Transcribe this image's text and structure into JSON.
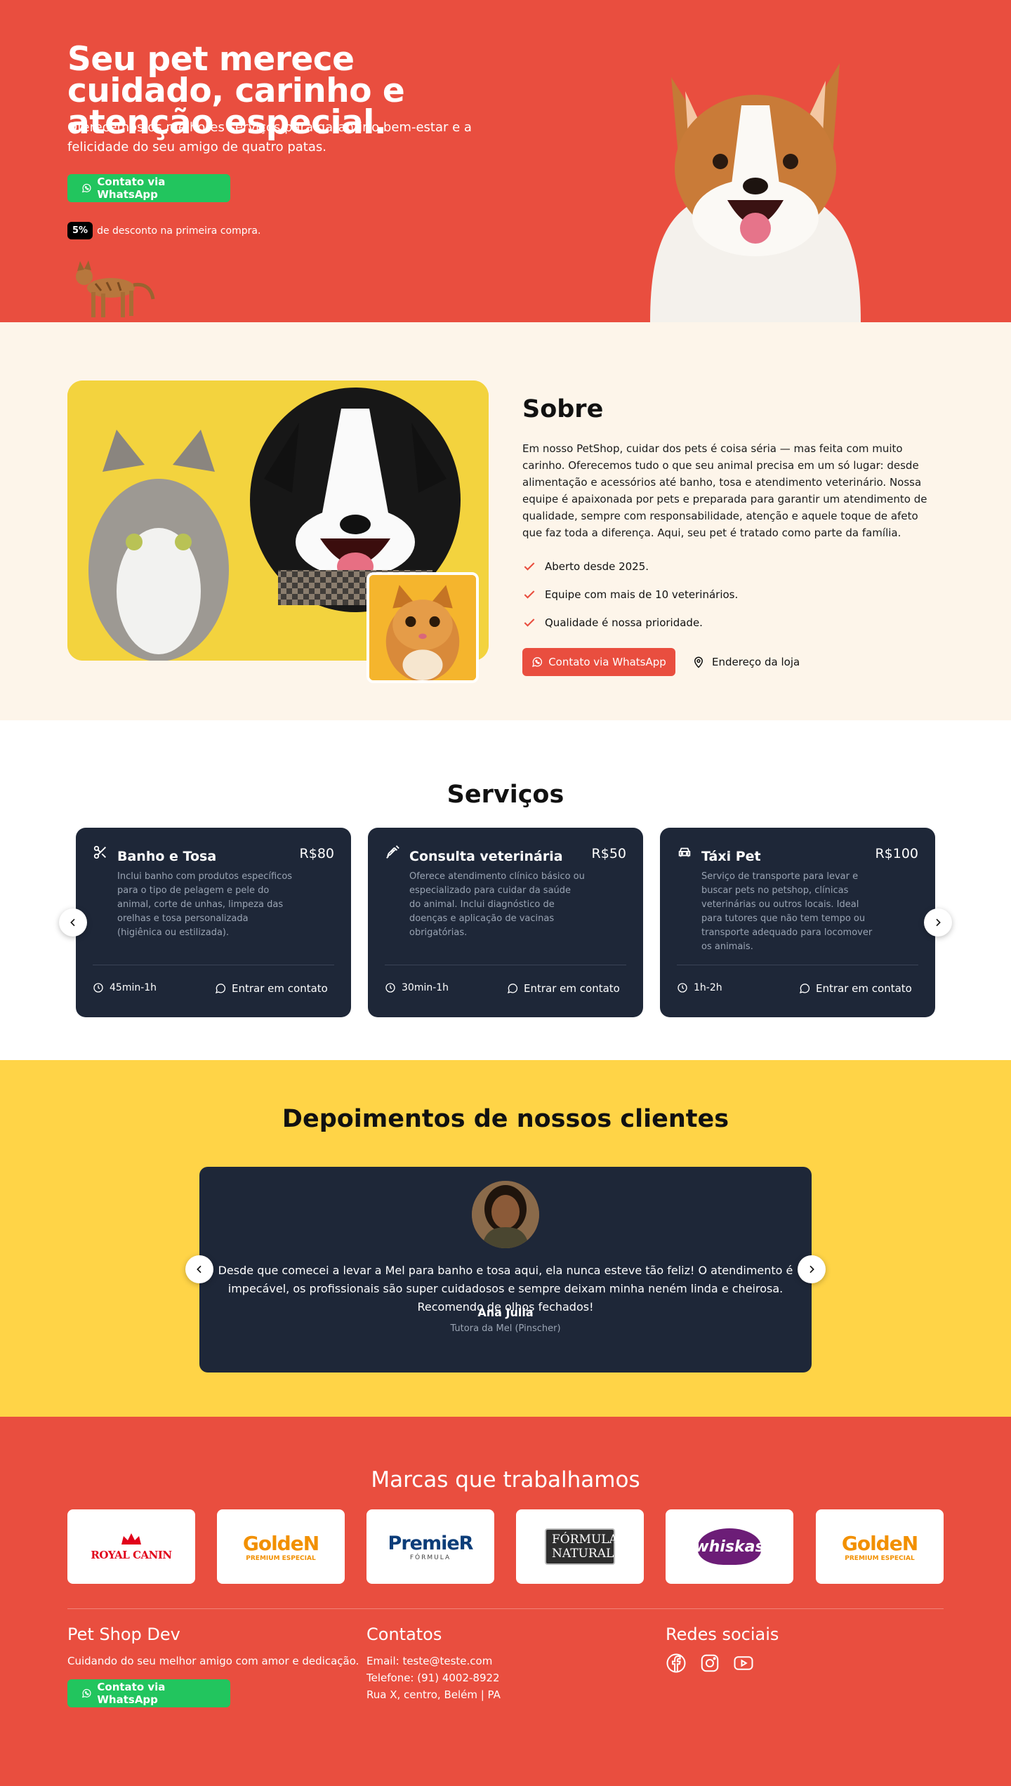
{
  "colors": {
    "primary": "#e94e3f",
    "whatsapp": "#22c55e",
    "dark_card": "#1e2738",
    "cream": "#fdf5ea",
    "yellow": "#ffd447"
  },
  "hero": {
    "title": "Seu pet merece cuidado, carinho e atenção especial.",
    "subtitle": "Oferecemos os melhores serviços para garantir o bem-estar e a felicidade do seu amigo de quatro patas.",
    "cta_label": "Contato via WhatsApp",
    "discount_badge": "5%",
    "discount_text": "de desconto na primeira compra."
  },
  "about": {
    "title": "Sobre",
    "paragraph": "Em nosso PetShop, cuidar dos pets é coisa séria — mas feita com muito carinho. Oferecemos tudo o que seu animal precisa em um só lugar: desde alimentação e acessórios até banho, tosa e atendimento veterinário. Nossa equipe é apaixonada por pets e preparada para garantir um atendimento de qualidade, sempre com responsabilidade, atenção e aquele toque de afeto que faz toda a diferença. Aqui, seu pet é tratado como parte da família.",
    "features": [
      "Aberto desde 2025.",
      "Equipe com mais de 10 veterinários.",
      "Qualidade é nossa prioridade."
    ],
    "cta_label": "Contato via WhatsApp",
    "address_label": "Endereço da loja"
  },
  "services": {
    "title": "Serviços",
    "items": [
      {
        "icon": "scissors-icon",
        "name": "Banho e Tosa",
        "price": "R$80",
        "description": "Inclui banho com produtos específicos para o tipo de pelagem e pele do animal, corte de unhas, limpeza das orelhas e tosa personalizada (higiênica ou estilizada).",
        "duration": "45min-1h",
        "contact": "Entrar em contato"
      },
      {
        "icon": "syringe-icon",
        "name": "Consulta veterinária",
        "price": "R$50",
        "description": "Oferece atendimento clínico básico ou especializado para cuidar da saúde do animal. Inclui diagnóstico de doenças e aplicação de vacinas obrigatórias.",
        "duration": "30min-1h",
        "contact": "Entrar em contato"
      },
      {
        "icon": "car-icon",
        "name": "Táxi Pet",
        "price": "R$100",
        "description": "Serviço de transporte para levar e buscar pets no petshop, clínicas veterinárias ou outros locais. Ideal para tutores que não tem tempo ou transporte adequado para locomover os animais.",
        "duration": "1h-2h",
        "contact": "Entrar em contato"
      }
    ]
  },
  "testimonials": {
    "title": "Depoimentos de nossos clientes",
    "current": {
      "quote": "Desde que comecei a levar a Mel para banho e tosa aqui, ela nunca esteve tão feliz! O atendimento é impecável, os profissionais são super cuidadosos e sempre deixam minha neném linda e cheirosa. Recomendo de olhos fechados!",
      "author": "Ana Julia",
      "role": "Tutora da Mel (Pinscher)"
    }
  },
  "brands": {
    "title": "Marcas que trabalhamos",
    "items": [
      {
        "name": "ROYAL CANIN",
        "color": "#e1001a"
      },
      {
        "name": "GoldeN",
        "tag": "PREMIUM ESPECIAL",
        "color": "#f29000"
      },
      {
        "name": "PremieR",
        "tag": "FÓRMULA",
        "color": "#0c3d79"
      },
      {
        "name": "FÓRMULA NATURAL",
        "color": "#2e2e2e"
      },
      {
        "name": "whiskas",
        "color": "#6c1d77"
      },
      {
        "name": "GoldeN",
        "tag": "PREMIUM ESPECIAL",
        "color": "#f29000"
      }
    ]
  },
  "footer": {
    "brand": {
      "title": "Pet Shop Dev",
      "tagline": "Cuidando do seu melhor amigo com amor e dedicação.",
      "cta_label": "Contato via WhatsApp"
    },
    "contacts": {
      "title": "Contatos",
      "email": "Email: teste@teste.com",
      "phone": "Telefone: (91) 4002-8922",
      "address": "Rua X, centro, Belém | PA"
    },
    "social": {
      "title": "Redes sociais",
      "icons": [
        "facebook-icon",
        "instagram-icon",
        "youtube-icon"
      ]
    }
  }
}
